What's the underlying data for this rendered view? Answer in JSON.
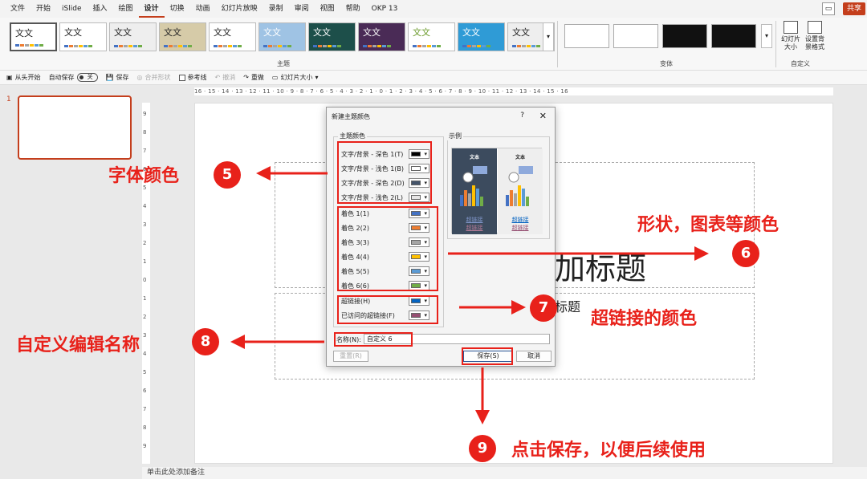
{
  "menu": [
    "文件",
    "开始",
    "iSlide",
    "插入",
    "绘图",
    "设计",
    "切换",
    "动画",
    "幻灯片放映",
    "录制",
    "审阅",
    "视图",
    "帮助",
    "OKP 13"
  ],
  "share_label": "共享",
  "ribbon": {
    "themes_label": "主题",
    "variants_label": "变体",
    "custom_label": "自定义",
    "theme_tiles": [
      "文文",
      "文文",
      "文文",
      "文文",
      "文文",
      "文文",
      "文文",
      "文文",
      "文文",
      "文文",
      "文文"
    ],
    "slide_size": "幻灯片\n大小",
    "format_bg": "设置背\n景格式"
  },
  "qat": {
    "from_start": "从头开始",
    "autosave": "自动保存",
    "toggle_off": "关",
    "save": "保存",
    "merge_shapes": "合并形状",
    "guides": "参考线",
    "undo": "撤消",
    "redo": "重做",
    "slide_size": "幻灯片大小"
  },
  "slide_number": "1",
  "ruler_h": "16 · 15 · 14 · 13 · 12 · 11 · 10 · 9 · 8 · 7 · 6 · 5 · 4 · 3 · 2 · 1 · 0 · 1 · 2 · 3 · 4 · 5 · 6 · 7 · 8 · 9 · 10 · 11 · 12 · 13 · 14 · 15 · 16",
  "slide": {
    "title_text": "加标题",
    "subtitle_text": "标题"
  },
  "notes": "单击此处添加备注",
  "dialog": {
    "title": "新建主题颜色",
    "help": "?",
    "close": "✕",
    "group_theme": "主题颜色",
    "group_sample": "示例",
    "rows": [
      {
        "label": "文字/背景 - 深色 1(T)",
        "color": "#000000"
      },
      {
        "label": "文字/背景 - 浅色 1(B)",
        "color": "#ffffff"
      },
      {
        "label": "文字/背景 - 深色 2(D)",
        "color": "#44546a"
      },
      {
        "label": "文字/背景 - 浅色 2(L)",
        "color": "#e7e6e6"
      },
      {
        "label": "着色 1(1)",
        "color": "#4472c4"
      },
      {
        "label": "着色 2(2)",
        "color": "#ed7d31"
      },
      {
        "label": "着色 3(3)",
        "color": "#a5a5a5"
      },
      {
        "label": "着色 4(4)",
        "color": "#ffc000"
      },
      {
        "label": "着色 5(5)",
        "color": "#5b9bd5"
      },
      {
        "label": "着色 6(6)",
        "color": "#70ad47"
      },
      {
        "label": "超链接(H)",
        "color": "#0563c1"
      },
      {
        "label": "已访问的超链接(F)",
        "color": "#954f72"
      }
    ],
    "preview_text": "文本",
    "preview_link": "超链接",
    "preview_visited": "超链接",
    "name_label": "名称(N):",
    "name_value": "自定义 6",
    "reset_btn": "重置(R)",
    "save_btn": "保存(S)",
    "cancel_btn": "取消"
  },
  "annotations": {
    "a5_text": "字体颜色",
    "a5_num": "5",
    "a6_text": "形状，图表等颜色",
    "a6_num": "6",
    "a7_text": "超链接的颜色",
    "a7_num": "7",
    "a8_text": "自定义编辑名称",
    "a8_num": "8",
    "a9_text": "点击保存，以便后续使用",
    "a9_num": "9"
  },
  "colors": {
    "accent": "#c43e1c",
    "annotation": "#e8211a"
  }
}
